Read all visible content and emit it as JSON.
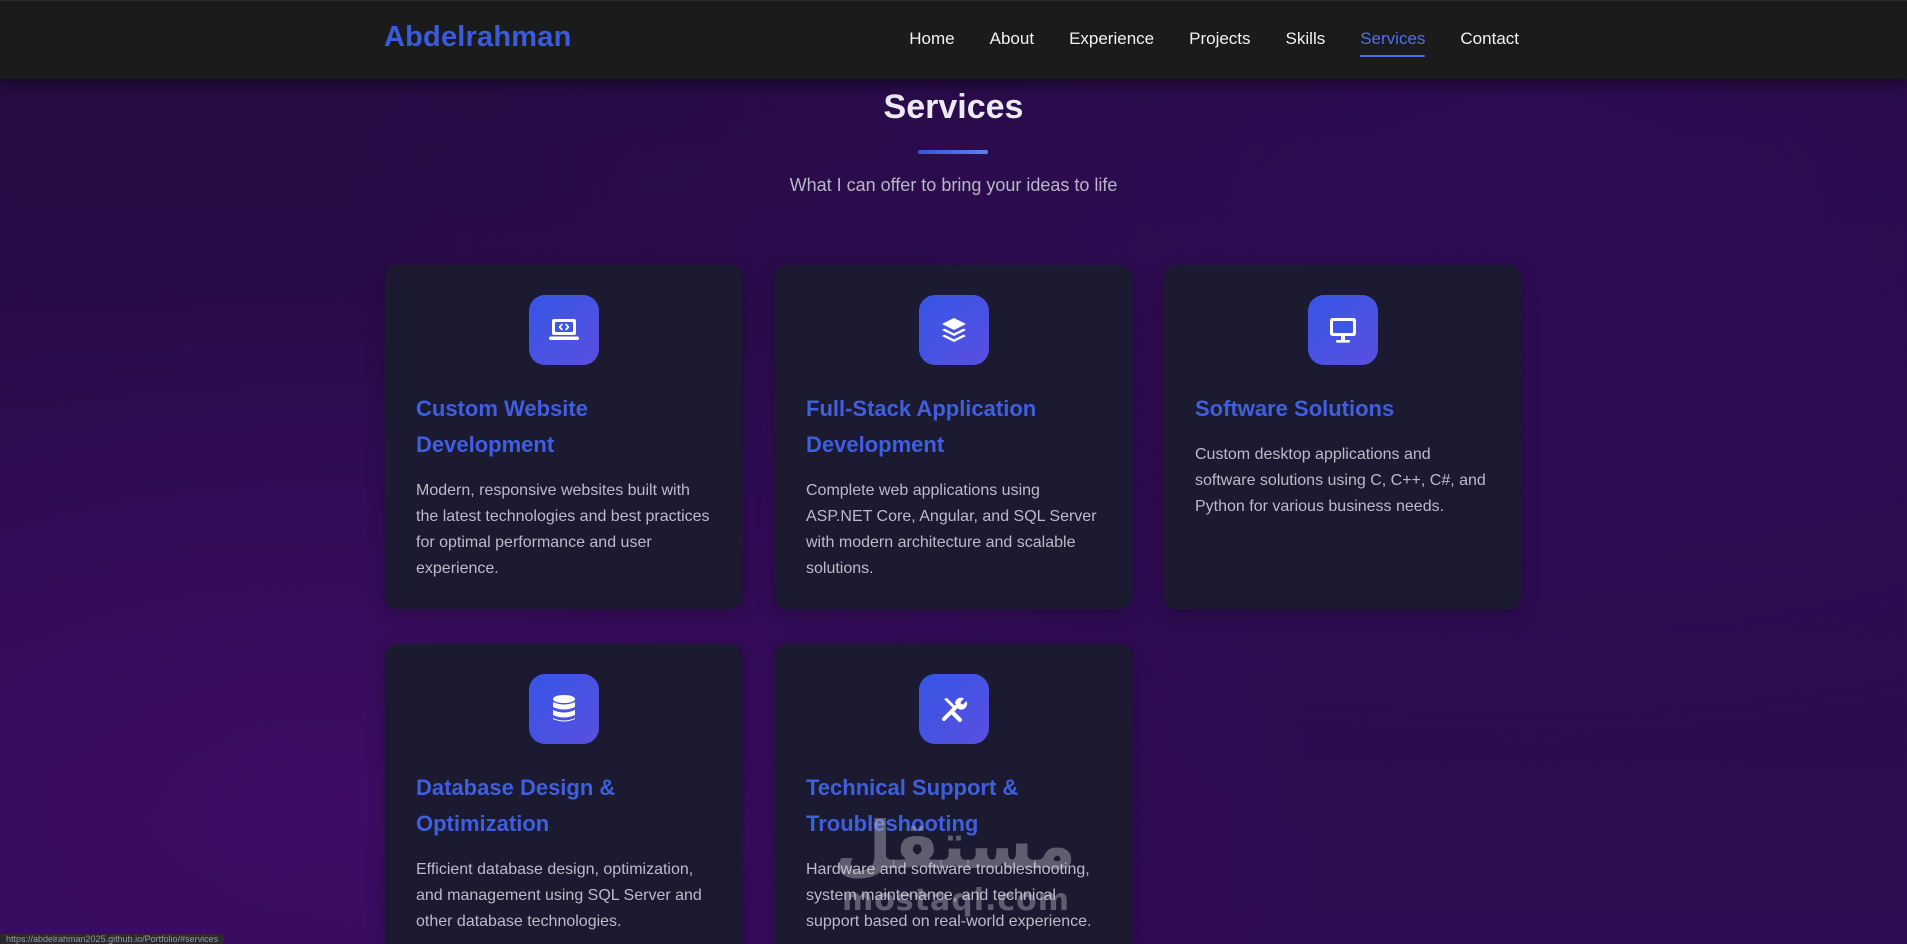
{
  "brand": "Abdelrahman",
  "nav": {
    "items": [
      {
        "label": "Home"
      },
      {
        "label": "About"
      },
      {
        "label": "Experience"
      },
      {
        "label": "Projects"
      },
      {
        "label": "Skills"
      },
      {
        "label": "Services",
        "active": true
      },
      {
        "label": "Contact"
      }
    ]
  },
  "section": {
    "title": "Services",
    "subtitle": "What I can offer to bring your ideas to life"
  },
  "cards": [
    {
      "icon": "laptop-code-icon",
      "title": "Custom Website Development",
      "description": "Modern, responsive websites built with the latest technologies and best practices for optimal performance and user experience."
    },
    {
      "icon": "layers-icon",
      "title": "Full-Stack Application Development",
      "description": "Complete web applications using ASP.NET Core, Angular, and SQL Server with modern architecture and scalable solutions."
    },
    {
      "icon": "desktop-icon",
      "title": "Software Solutions",
      "description": "Custom desktop applications and software solutions using C, C++, C#, and Python for various business needs."
    },
    {
      "icon": "database-icon",
      "title": "Database Design & Optimization",
      "description": "Efficient database design, optimization, and management using SQL Server and other database technologies."
    },
    {
      "icon": "tools-icon",
      "title": "Technical Support & Troubleshooting",
      "description": "Hardware and software troubleshooting, system maintenance, and technical support based on real-world experience."
    }
  ],
  "watermark": {
    "arabic": "مستقل",
    "latin": "mostaql.com"
  },
  "status_url": "https://abdelrahman2025.github.io/Portfolio/#services",
  "colors": {
    "accent": "#3f5fe0",
    "nav_background": "#1b1b1b",
    "card_background": "#1c1a30",
    "page_background": "#2a0c4b"
  }
}
